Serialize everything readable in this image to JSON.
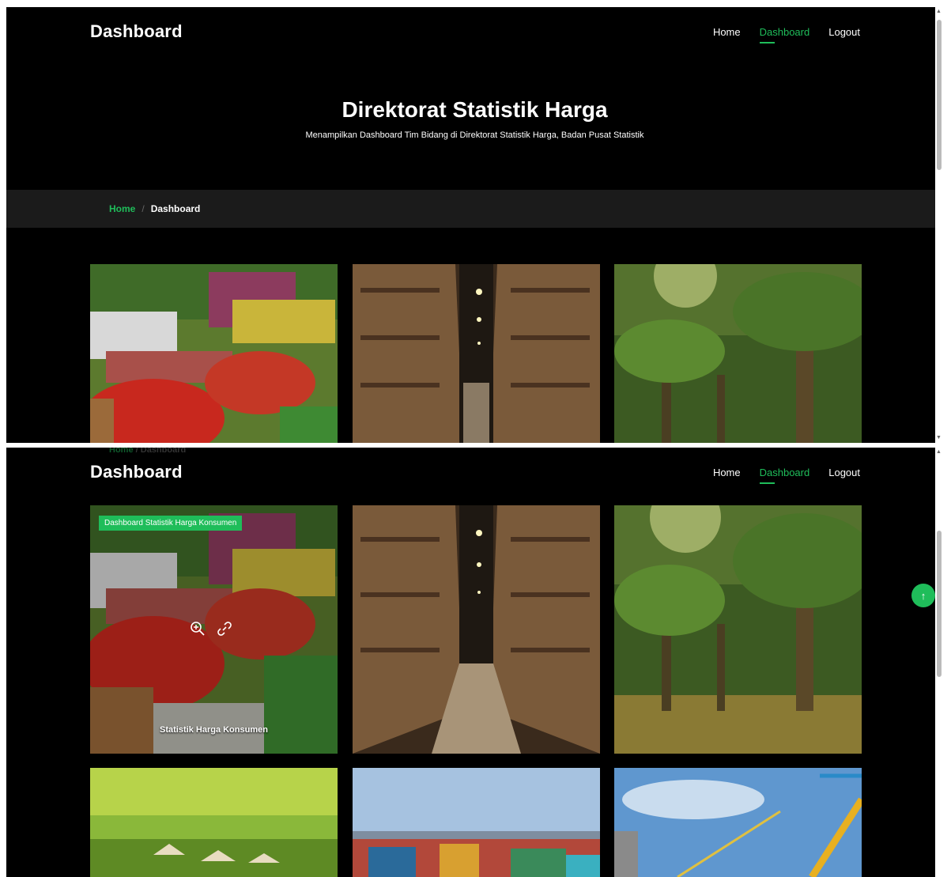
{
  "header": {
    "brand": "Dashboard",
    "nav": [
      {
        "label": "Home"
      },
      {
        "label": "Dashboard"
      },
      {
        "label": "Logout"
      }
    ]
  },
  "hero": {
    "title": "Direktorat Statistik Harga",
    "subtitle": "Menampilkan Dashboard Tim Bidang di Direktorat Statistik Harga, Badan Pusat Statistik"
  },
  "breadcrumb": {
    "home": "Home",
    "separator": "/",
    "current": "Dashboard"
  },
  "hovered_card": {
    "category_tag": "Dashboard Statistik Harga Konsumen",
    "title": "Statistik Harga Konsumen",
    "icons": [
      "zoom-in-icon",
      "link-icon"
    ]
  },
  "colors": {
    "accent": "#1fbd5a",
    "background": "#000000",
    "breadcrumb_bar": "#1b1b1b"
  }
}
